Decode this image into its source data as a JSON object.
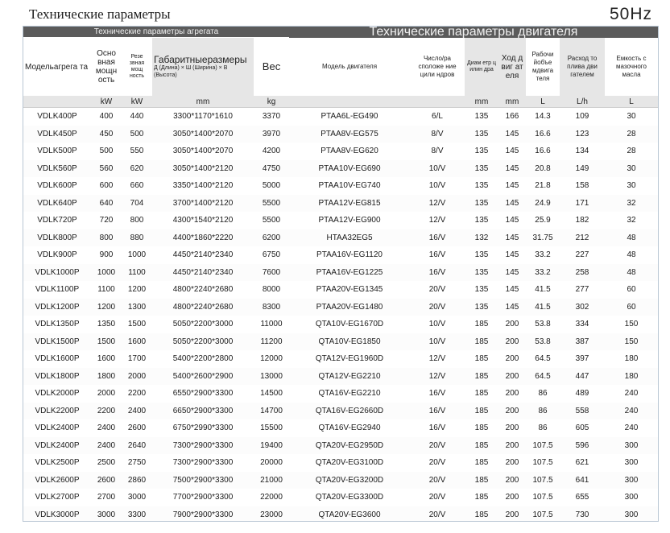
{
  "page_title": "Технические параметры",
  "frequency": "50Hz",
  "bands": {
    "unit": "Технические параметры агрегата",
    "engine": "Технические параметры двигателя"
  },
  "headers": {
    "model": "Модельагрега та",
    "main_power": "Осно вная мощн ость",
    "standby_power": "Резе звная мощ ность",
    "dims_title": "Габаритныеразмеры",
    "dims_sub": "Д (Длина) × Ш (Ширина) × В (Высота)",
    "weight": "Вес",
    "engine_model": "Модель двигателя",
    "cylinders": "Числo/ра сположе ние цили ндров",
    "bore": "Диам етр ц илин дра",
    "stroke": "Ход д виг ат еля",
    "displacement": "Рабочи йобъе мдвига теля",
    "fuel": "Расход то плива дви гателем",
    "oil": "Емкость с мазочного масла"
  },
  "units": {
    "main_power": "kW",
    "standby_power": "kW",
    "dims": "mm",
    "weight": "kg",
    "engine_model": "",
    "cylinders": "",
    "bore": "mm",
    "stroke": "mm",
    "displacement": "L",
    "fuel": "L/h",
    "oil": "L"
  },
  "rows": [
    {
      "model": "VDLK400P",
      "main": "400",
      "standby": "440",
      "dims": "3300*1170*1610",
      "weight": "3370",
      "engine": "PTAA6L-EG490",
      "cyl": "6/L",
      "bore": "135",
      "stroke": "166",
      "disp": "14.3",
      "fuel": "109",
      "oil": "30"
    },
    {
      "model": "VDLK450P",
      "main": "450",
      "standby": "500",
      "dims": "3050*1400*2070",
      "weight": "3970",
      "engine": "PTAA8V-EG575",
      "cyl": "8/V",
      "bore": "135",
      "stroke": "145",
      "disp": "16.6",
      "fuel": "123",
      "oil": "28"
    },
    {
      "model": "VDLK500P",
      "main": "500",
      "standby": "550",
      "dims": "3050*1400*2070",
      "weight": "4200",
      "engine": "PTAA8V-EG620",
      "cyl": "8/V",
      "bore": "135",
      "stroke": "145",
      "disp": "16.6",
      "fuel": "134",
      "oil": "28"
    },
    {
      "model": "VDLK560P",
      "main": "560",
      "standby": "620",
      "dims": "3050*1400*2120",
      "weight": "4750",
      "engine": "PTAA10V-EG690",
      "cyl": "10/V",
      "bore": "135",
      "stroke": "145",
      "disp": "20.8",
      "fuel": "149",
      "oil": "30"
    },
    {
      "model": "VDLK600P",
      "main": "600",
      "standby": "660",
      "dims": "3350*1400*2120",
      "weight": "5000",
      "engine": "PTAA10V-EG740",
      "cyl": "10/V",
      "bore": "135",
      "stroke": "145",
      "disp": "21.8",
      "fuel": "158",
      "oil": "30"
    },
    {
      "model": "VDLK640P",
      "main": "640",
      "standby": "704",
      "dims": "3700*1400*2120",
      "weight": "5500",
      "engine": "PTAA12V-EG815",
      "cyl": "12/V",
      "bore": "135",
      "stroke": "145",
      "disp": "24.9",
      "fuel": "171",
      "oil": "32"
    },
    {
      "model": "VDLK720P",
      "main": "720",
      "standby": "800",
      "dims": "4300*1540*2120",
      "weight": "5500",
      "engine": "PTAA12V-EG900",
      "cyl": "12/V",
      "bore": "135",
      "stroke": "145",
      "disp": "25.9",
      "fuel": "182",
      "oil": "32"
    },
    {
      "model": "VDLK800P",
      "main": "800",
      "standby": "880",
      "dims": "4400*1860*2220",
      "weight": "6200",
      "engine": "HTAA32EG5",
      "cyl": "16/V",
      "bore": "132",
      "stroke": "145",
      "disp": "31.75",
      "fuel": "212",
      "oil": "48"
    },
    {
      "model": "VDLK900P",
      "main": "900",
      "standby": "1000",
      "dims": "4450*2140*2340",
      "weight": "6750",
      "engine": "PTAA16V-EG1120",
      "cyl": "16/V",
      "bore": "135",
      "stroke": "145",
      "disp": "33.2",
      "fuel": "227",
      "oil": "48"
    },
    {
      "model": "VDLK1000P",
      "main": "1000",
      "standby": "1100",
      "dims": "4450*2140*2340",
      "weight": "7600",
      "engine": "PTAA16V-EG1225",
      "cyl": "16/V",
      "bore": "135",
      "stroke": "145",
      "disp": "33.2",
      "fuel": "258",
      "oil": "48"
    },
    {
      "model": "VDLK1100P",
      "main": "1100",
      "standby": "1200",
      "dims": "4800*2240*2680",
      "weight": "8000",
      "engine": "PTAA20V-EG1345",
      "cyl": "20/V",
      "bore": "135",
      "stroke": "145",
      "disp": "41.5",
      "fuel": "277",
      "oil": "60"
    },
    {
      "model": "VDLK1200P",
      "main": "1200",
      "standby": "1300",
      "dims": "4800*2240*2680",
      "weight": "8300",
      "engine": "PTAA20V-EG1480",
      "cyl": "20/V",
      "bore": "135",
      "stroke": "145",
      "disp": "41.5",
      "fuel": "302",
      "oil": "60"
    },
    {
      "model": "VDLK1350P",
      "main": "1350",
      "standby": "1500",
      "dims": "5050*2200*3000",
      "weight": "11000",
      "engine": "QTA10V-EG1670D",
      "cyl": "10/V",
      "bore": "185",
      "stroke": "200",
      "disp": "53.8",
      "fuel": "334",
      "oil": "150"
    },
    {
      "model": "VDLK1500P",
      "main": "1500",
      "standby": "1600",
      "dims": "5050*2200*3000",
      "weight": "11200",
      "engine": "QTA10V-EG1850",
      "cyl": "10/V",
      "bore": "185",
      "stroke": "200",
      "disp": "53.8",
      "fuel": "387",
      "oil": "150"
    },
    {
      "model": "VDLK1600P",
      "main": "1600",
      "standby": "1700",
      "dims": "5400*2200*2800",
      "weight": "12000",
      "engine": "QTA12V-EG1960D",
      "cyl": "12/V",
      "bore": "185",
      "stroke": "200",
      "disp": "64.5",
      "fuel": "397",
      "oil": "180"
    },
    {
      "model": "VDLK1800P",
      "main": "1800",
      "standby": "2000",
      "dims": "5400*2600*2900",
      "weight": "13000",
      "engine": "QTA12V-EG2210",
      "cyl": "12/V",
      "bore": "185",
      "stroke": "200",
      "disp": "64.5",
      "fuel": "447",
      "oil": "180"
    },
    {
      "model": "VDLK2000P",
      "main": "2000",
      "standby": "2200",
      "dims": "6550*2900*3300",
      "weight": "14500",
      "engine": "QTA16V-EG2210",
      "cyl": "16/V",
      "bore": "185",
      "stroke": "200",
      "disp": "86",
      "fuel": "489",
      "oil": "240"
    },
    {
      "model": "VDLK2200P",
      "main": "2200",
      "standby": "2400",
      "dims": "6650*2900*3300",
      "weight": "14700",
      "engine": "QTA16V-EG2660D",
      "cyl": "16/V",
      "bore": "185",
      "stroke": "200",
      "disp": "86",
      "fuel": "558",
      "oil": "240"
    },
    {
      "model": "VDLK2400P",
      "main": "2400",
      "standby": "2600",
      "dims": "6750*2990*3300",
      "weight": "15500",
      "engine": "QTA16V-EG2940",
      "cyl": "16/V",
      "bore": "185",
      "stroke": "200",
      "disp": "86",
      "fuel": "605",
      "oil": "240"
    },
    {
      "model": "VDLK2400P",
      "main": "2400",
      "standby": "2640",
      "dims": "7300*2900*3300",
      "weight": "19400",
      "engine": "QTA20V-EG2950D",
      "cyl": "20/V",
      "bore": "185",
      "stroke": "200",
      "disp": "107.5",
      "fuel": "596",
      "oil": "300"
    },
    {
      "model": "VDLK2500P",
      "main": "2500",
      "standby": "2750",
      "dims": "7300*2900*3300",
      "weight": "20000",
      "engine": "QTA20V-EG3100D",
      "cyl": "20/V",
      "bore": "185",
      "stroke": "200",
      "disp": "107.5",
      "fuel": "621",
      "oil": "300"
    },
    {
      "model": "VDLK2600P",
      "main": "2600",
      "standby": "2860",
      "dims": "7500*2900*3300",
      "weight": "21000",
      "engine": "QTA20V-EG3200D",
      "cyl": "20/V",
      "bore": "185",
      "stroke": "200",
      "disp": "107.5",
      "fuel": "641",
      "oil": "300"
    },
    {
      "model": "VDLK2700P",
      "main": "2700",
      "standby": "3000",
      "dims": "7700*2900*3300",
      "weight": "22000",
      "engine": "QTA20V-EG3300D",
      "cyl": "20/V",
      "bore": "185",
      "stroke": "200",
      "disp": "107.5",
      "fuel": "655",
      "oil": "300"
    },
    {
      "model": "VDLK3000P",
      "main": "3000",
      "standby": "3300",
      "dims": "7900*2900*3300",
      "weight": "23000",
      "engine": "QTA20V-EG3600",
      "cyl": "20/V",
      "bore": "185",
      "stroke": "200",
      "disp": "107.5",
      "fuel": "730",
      "oil": "300"
    }
  ]
}
